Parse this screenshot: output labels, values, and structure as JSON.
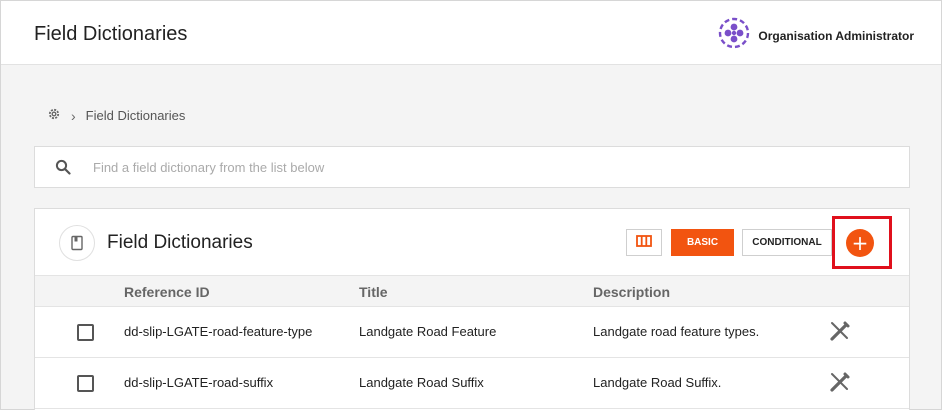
{
  "header": {
    "title": "Field Dictionaries",
    "user_name": "Organisation Administrator",
    "user_icon": "org-logo-icon"
  },
  "breadcrumb": {
    "home_icon": "gear-icon",
    "current": "Field Dictionaries"
  },
  "search": {
    "placeholder": "Find a field dictionary from the list below"
  },
  "panel": {
    "title": "Field Dictionaries",
    "basic_label": "BASIC",
    "conditional_label": "CONDITIONAL",
    "add_label": "+",
    "accent_color": "#f25410",
    "highlight_color": "#e0101c"
  },
  "table": {
    "headers": [
      "Reference ID",
      "Title",
      "Description"
    ],
    "rows": [
      {
        "ref": "dd-slip-LGATE-road-feature-type",
        "title": "Landgate Road Feature",
        "description": "Landgate road feature types."
      },
      {
        "ref": "dd-slip-LGATE-road-suffix",
        "title": "Landgate Road Suffix",
        "description": "Landgate Road Suffix."
      }
    ]
  }
}
